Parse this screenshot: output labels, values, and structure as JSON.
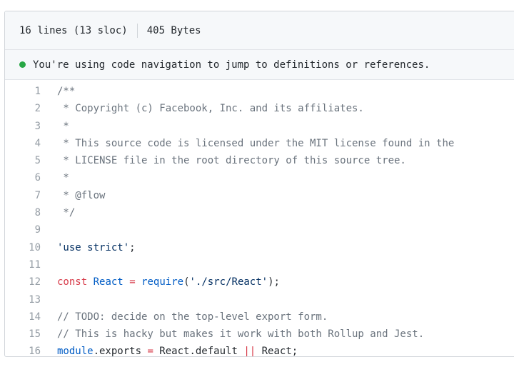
{
  "header": {
    "lines_info": "16 lines (13 sloc)",
    "size_info": "405 Bytes"
  },
  "banner": {
    "message": "You're using code navigation to jump to definitions or references.",
    "dot_color": "#28a745"
  },
  "code_lines": [
    {
      "num": "1",
      "tokens": [
        {
          "t": "/**",
          "c": "comment"
        }
      ]
    },
    {
      "num": "2",
      "tokens": [
        {
          "t": " * Copyright (c) Facebook, Inc. and its affiliates.",
          "c": "comment"
        }
      ]
    },
    {
      "num": "3",
      "tokens": [
        {
          "t": " *",
          "c": "comment"
        }
      ]
    },
    {
      "num": "4",
      "tokens": [
        {
          "t": " * This source code is licensed under the MIT license found in the",
          "c": "comment"
        }
      ]
    },
    {
      "num": "5",
      "tokens": [
        {
          "t": " * LICENSE file in the root directory of this source tree.",
          "c": "comment"
        }
      ]
    },
    {
      "num": "6",
      "tokens": [
        {
          "t": " *",
          "c": "comment"
        }
      ]
    },
    {
      "num": "7",
      "tokens": [
        {
          "t": " * @flow",
          "c": "comment"
        }
      ]
    },
    {
      "num": "8",
      "tokens": [
        {
          "t": " */",
          "c": "comment"
        }
      ]
    },
    {
      "num": "9",
      "tokens": []
    },
    {
      "num": "10",
      "tokens": [
        {
          "t": "'use strict'",
          "c": "string"
        },
        {
          "t": ";",
          "c": "plain"
        }
      ]
    },
    {
      "num": "11",
      "tokens": []
    },
    {
      "num": "12",
      "tokens": [
        {
          "t": "const",
          "c": "keyword"
        },
        {
          "t": " ",
          "c": "plain"
        },
        {
          "t": "React",
          "c": "const"
        },
        {
          "t": " ",
          "c": "plain"
        },
        {
          "t": "=",
          "c": "keyword"
        },
        {
          "t": " ",
          "c": "plain"
        },
        {
          "t": "require",
          "c": "const"
        },
        {
          "t": "(",
          "c": "plain"
        },
        {
          "t": "'./src/React'",
          "c": "string"
        },
        {
          "t": ");",
          "c": "plain"
        }
      ]
    },
    {
      "num": "13",
      "tokens": []
    },
    {
      "num": "14",
      "tokens": [
        {
          "t": "// TODO: decide on the top-level export form.",
          "c": "comment"
        }
      ]
    },
    {
      "num": "15",
      "tokens": [
        {
          "t": "// This is hacky but makes it work with both Rollup and Jest.",
          "c": "comment"
        }
      ]
    },
    {
      "num": "16",
      "tokens": [
        {
          "t": "module",
          "c": "const"
        },
        {
          "t": ".exports ",
          "c": "plain"
        },
        {
          "t": "=",
          "c": "keyword"
        },
        {
          "t": " React.default ",
          "c": "plain"
        },
        {
          "t": "||",
          "c": "keyword"
        },
        {
          "t": " React;",
          "c": "plain"
        }
      ]
    }
  ]
}
